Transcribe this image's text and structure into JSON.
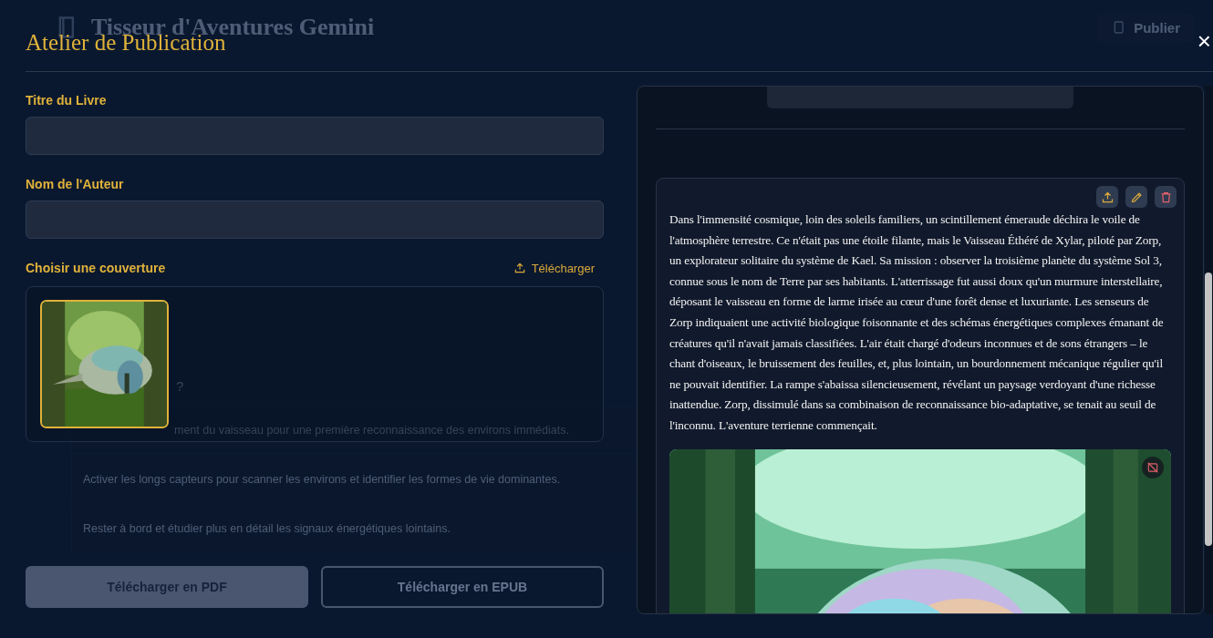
{
  "background": {
    "app_title": "Tisseur d'Aventures Gemini",
    "publish_button": "Publier",
    "question": "?",
    "choices": [
      "ment du vaisseau pour une première reconnaissance des environs immédiats.",
      "Activer les longs capteurs pour scanner les environs et identifier les formes de vie dominantes.",
      "Rester à bord et étudier plus en détail les signaux énergétiques lointains."
    ]
  },
  "modal": {
    "title": "Atelier de Publication",
    "close": "×",
    "fields": [
      {
        "label": "Titre du Livre"
      },
      {
        "label": "Nom de l'Auteur"
      }
    ],
    "cover": {
      "label": "Choisir une couverture",
      "upload": "Télécharger",
      "options": [
        {
          "selected": true
        }
      ]
    },
    "buttons": [
      {
        "label": "Télécharger en PDF",
        "kind": "primary"
      },
      {
        "label": "Télécharger en EPUB",
        "kind": "outline"
      }
    ],
    "preview": {
      "story": "Dans l'immensité cosmique, loin des soleils familiers, un scintillement émeraude déchira le voile de l'atmosphère terrestre. Ce n'était pas une étoile filante, mais le Vaisseau Éthéré de Xylar, piloté par Zorp, un explorateur solitaire du système de Kael. Sa mission : observer la troisième planète du système Sol 3, connue sous le nom de Terre par ses habitants. L'atterrissage fut aussi doux qu'un murmure interstellaire, déposant le vaisseau en forme de larme irisée au cœur d'une forêt dense et luxuriante. Les senseurs de Zorp indiquaient une activité biologique foisonnante et des schémas énergétiques complexes émanant de créatures qu'il n'avait jamais classifiées. L'air était chargé d'odeurs inconnues et de sons étrangers – le chant d'oiseaux, le bruissement des feuilles, et, plus lointain, un bourdonnement mécanique régulier qu'il ne pouvait identifier. La rampe s'abaissa silencieusement, révélant un paysage verdoyant d'une richesse inattendue. Zorp, dissimulé dans sa combinaison de reconnaissance bio-adaptative, se tenait au seuil de l'inconnu. L'aventure terrienne commençait."
    }
  }
}
